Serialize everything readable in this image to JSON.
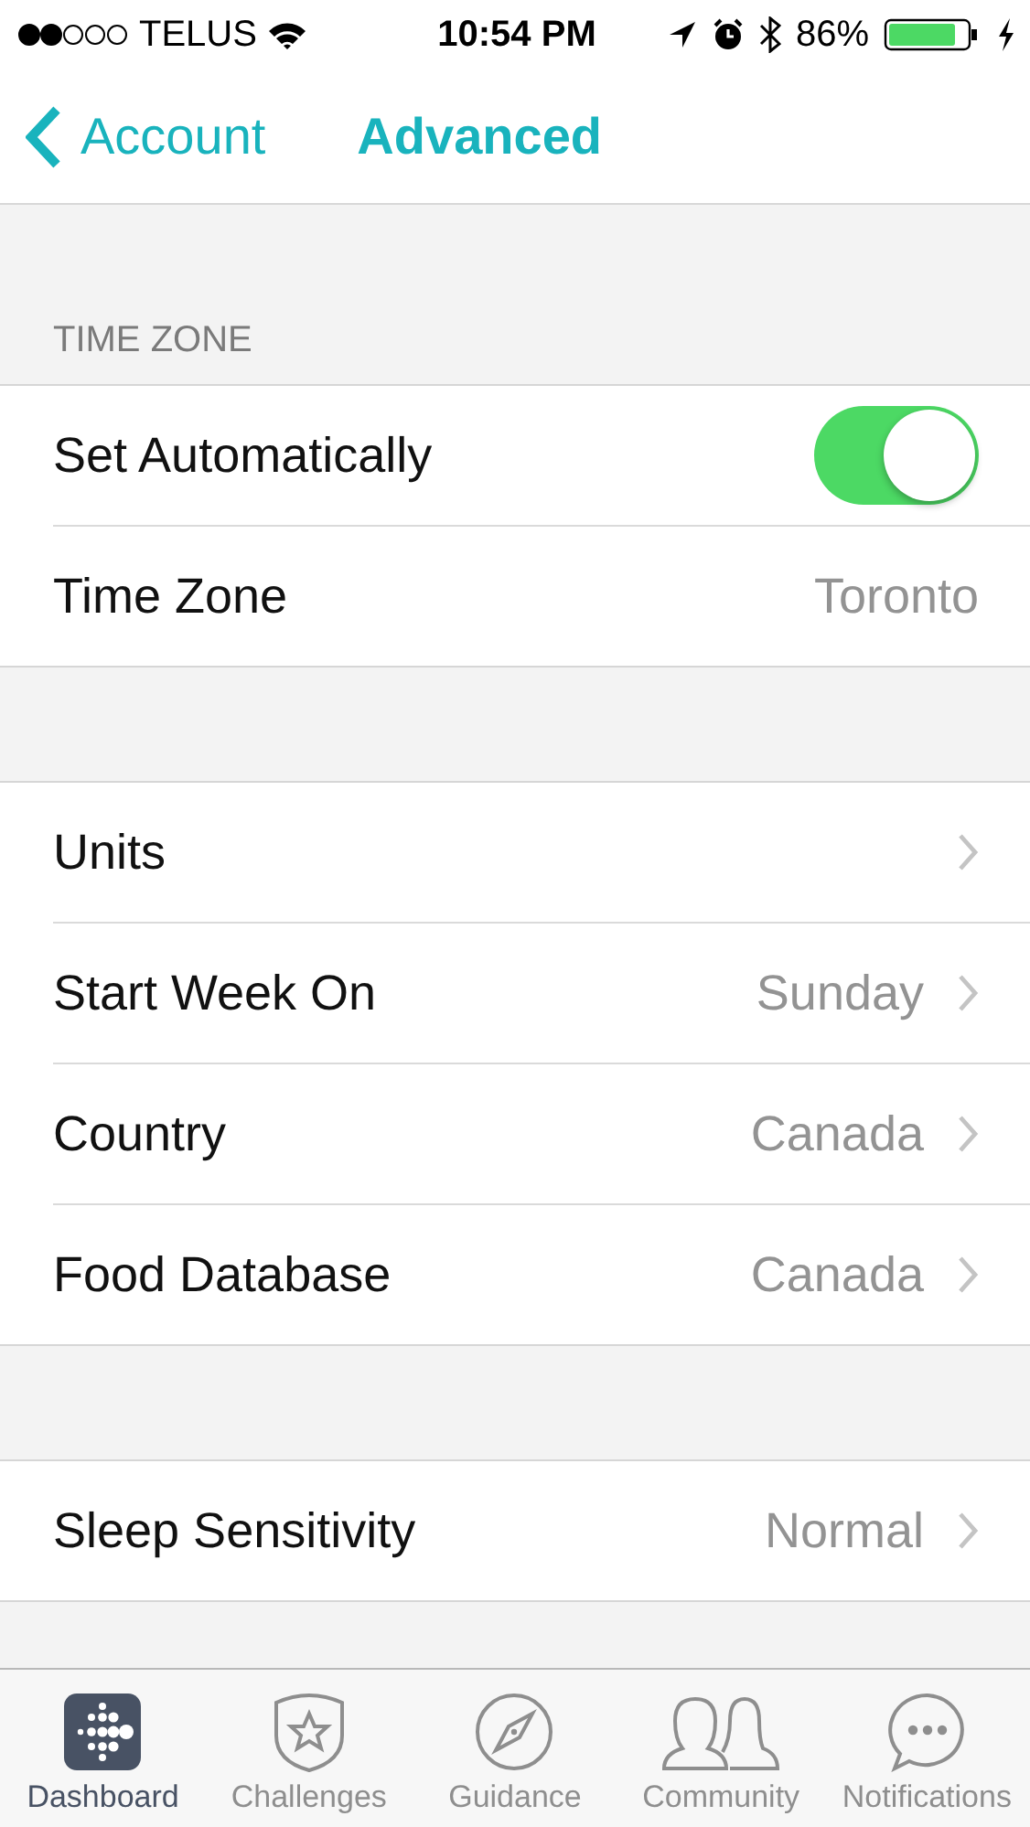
{
  "status_bar": {
    "carrier": "TELUS",
    "time": "10:54 PM",
    "battery": "86%"
  },
  "nav": {
    "back": "Account",
    "title": "Advanced"
  },
  "sections": [
    {
      "header": "TIME ZONE",
      "rows": [
        {
          "kind": "toggle",
          "label": "Set Automatically",
          "on": true
        },
        {
          "kind": "value",
          "label": "Time Zone",
          "value": "Toronto"
        }
      ]
    },
    {
      "rows": [
        {
          "kind": "link",
          "label": "Units"
        },
        {
          "kind": "link",
          "label": "Start Week On",
          "value": "Sunday"
        },
        {
          "kind": "link",
          "label": "Country",
          "value": "Canada"
        },
        {
          "kind": "link",
          "label": "Food Database",
          "value": "Canada"
        }
      ]
    },
    {
      "rows": [
        {
          "kind": "link",
          "label": "Sleep Sensitivity",
          "value": "Normal"
        }
      ]
    }
  ],
  "tabs": [
    {
      "label": "Dashboard",
      "selected": true
    },
    {
      "label": "Challenges",
      "selected": false
    },
    {
      "label": "Guidance",
      "selected": false
    },
    {
      "label": "Community",
      "selected": false
    },
    {
      "label": "Notifications",
      "selected": false
    }
  ]
}
